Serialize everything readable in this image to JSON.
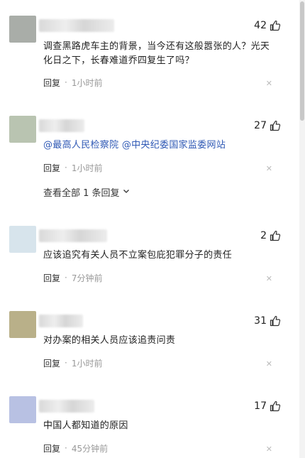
{
  "comments": [
    {
      "avatar_color": "#a9ada8",
      "likes": "42",
      "text": "调查黑路虎车主的背景，当今还有这般嚣张的人？光天化日之下，长春难道乔四复生了吗？",
      "reply_label": "回复",
      "time": "1小时前"
    },
    {
      "avatar_color": "#b9c4b1",
      "likes": "27",
      "text": "@最高人民检察院 @中央纪委国家监委网站",
      "reply_label": "回复",
      "time": "1小时前",
      "view_all": "查看全部 1 条回复"
    },
    {
      "avatar_color": "#d7e4ec",
      "likes": "2",
      "text": "应该追究有关人员不立案包庇犯罪分子的责任",
      "reply_label": "回复",
      "time": "7分钟前"
    },
    {
      "avatar_color": "#b9b089",
      "likes": "31",
      "text": "对办案的相关人员应该追责问责",
      "reply_label": "回复",
      "time": "1小时前"
    },
    {
      "avatar_color": "#b8c1e3",
      "likes": "17",
      "text": "中国人都知道的原因",
      "reply_label": "回复",
      "time": "45分钟前"
    }
  ],
  "separator": "·",
  "close_glyph": "✕",
  "icons": {
    "like": "thumbs-up-icon",
    "close": "close-icon",
    "expand": "chevron-down-icon"
  }
}
